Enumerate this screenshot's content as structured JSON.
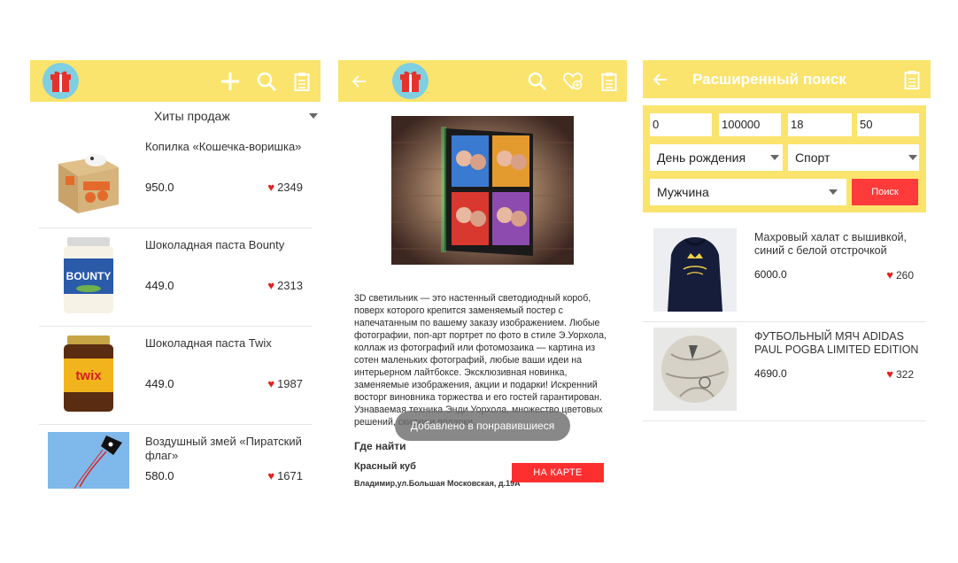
{
  "screen1": {
    "sort_label": "Хиты продаж",
    "items": [
      {
        "name": "Копилка «Кошечка-воришка»",
        "price": "950.0",
        "likes": "2349",
        "image": "cat-bank"
      },
      {
        "name": "Шоколадная паста Bounty",
        "price": "449.0",
        "likes": "2313",
        "image": "bounty-jar"
      },
      {
        "name": "Шоколадная паста Twix",
        "price": "449.0",
        "likes": "1987",
        "image": "twix-jar"
      },
      {
        "name": "Воздушный змей «Пиратский флаг»",
        "price": "580.0",
        "likes": "1671",
        "image": "pirate-kite"
      }
    ],
    "jar_labels": {
      "bounty": "BOUNTY",
      "twix": "twix"
    }
  },
  "screen2": {
    "description": "3D светильник — это настенный светодиодный короб, поверх которого крепится заменяемый постер с напечатанным по вашему заказу изображением. Любые фотографии, поп-арт портрет по фото в стиле Э.Уорхола, коллаж из фотографий или фотомозаика — картина из сотен маленьких фотографий, любые ваши идеи на интерьерном лайтбоксе. Эксклюзивная новинка, заменяемые изображения, акции и подарки! Искренний восторг виновника торжества и его гостей гарантирован. Узнаваемая техника Энди Уорхола, множество цветовых решений, скидки и подарки.",
    "toast": "Добавлено в понравившиеся",
    "where_title": "Где найти",
    "shop_name": "Красный куб",
    "shop_address": "Владимир,ул.Большая Московская, д.19А",
    "map_button": "НА КАРТЕ"
  },
  "screen3": {
    "title": "Расширенный поиск",
    "price_from": "0",
    "price_to": "100000",
    "age_from": "18",
    "age_to": "50",
    "occasion": "День рождения",
    "interest": "Спорт",
    "gender": "Мужчина",
    "search_button": "Поиск",
    "results": [
      {
        "name": "Махровый халат с вышивкой, синий с белой отстрочкой",
        "price": "6000.0",
        "likes": "260",
        "image": "bathrobe"
      },
      {
        "name": "ФУТБОЛЬНЫЙ МЯЧ ADIDAS PAUL POGBA LIMITED EDITION",
        "price": "4690.0",
        "likes": "322",
        "image": "football"
      }
    ]
  },
  "colors": {
    "bar": "#fbe46d",
    "accent_red": "#ff2f2f",
    "heart": "#e2211c",
    "gift_bg": "#7fcfe2"
  },
  "icons": {
    "screen1": [
      "gift-icon",
      "plus-icon",
      "search-icon",
      "clipboard-icon"
    ],
    "screen2": [
      "back-arrow-icon",
      "gift-icon",
      "search-icon",
      "heart-plus-icon",
      "clipboard-icon"
    ],
    "screen3": [
      "back-arrow-icon",
      "clipboard-icon"
    ]
  }
}
